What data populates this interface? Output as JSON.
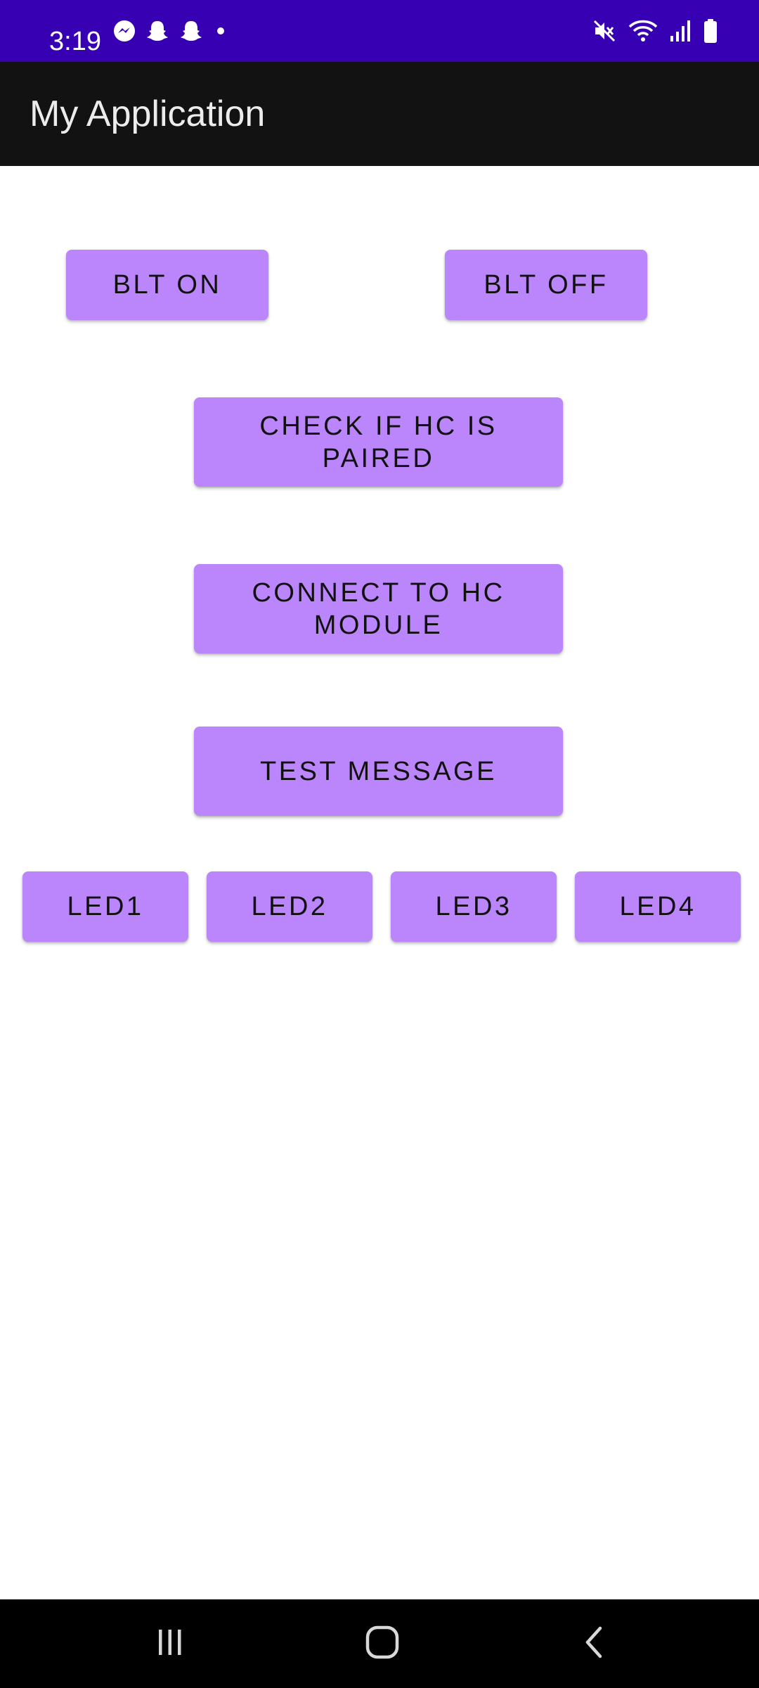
{
  "status_bar": {
    "time": "3:19",
    "notification_icons": [
      "messenger-icon",
      "snapchat-icon",
      "snapchat-icon",
      "dot-icon"
    ],
    "right_icons": [
      "mute-icon",
      "wifi-icon",
      "signal-icon",
      "battery-icon"
    ],
    "background_color": "#3700b3"
  },
  "app_bar": {
    "title": "My Application",
    "background_color": "#121212"
  },
  "buttons": {
    "blt_on": "BLT ON",
    "blt_off": "BLT OFF",
    "check_paired": "CHECK IF HC IS PAIRED",
    "connect_hc": "CONNECT TO HC MODULE",
    "test_message": "TEST MESSAGE",
    "led1": "LED1",
    "led2": "LED2",
    "led3": "LED3",
    "led4": "LED4",
    "color": "#bb86fc"
  },
  "nav_bar": {
    "items": [
      "recent-apps-icon",
      "home-icon",
      "back-icon"
    ]
  }
}
